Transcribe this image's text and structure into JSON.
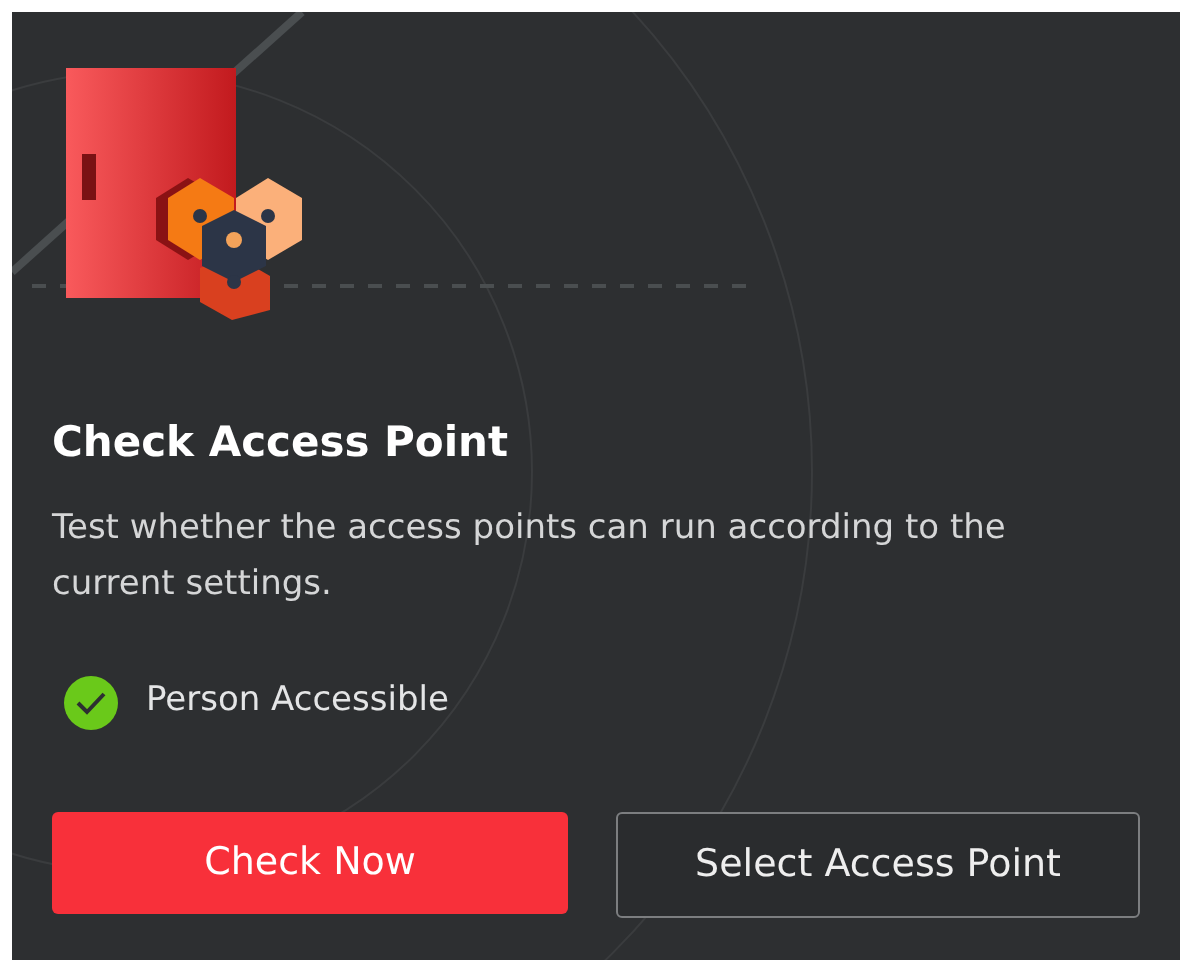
{
  "card": {
    "title": "Check Access Point",
    "description": "Test whether the access points can run according to the current settings.",
    "status": {
      "label": "Person Accessible",
      "checked": true
    },
    "buttons": [
      {
        "label": "Check Now",
        "kind": "primary"
      },
      {
        "label": "Select Access Point",
        "kind": "secondary"
      }
    ]
  }
}
